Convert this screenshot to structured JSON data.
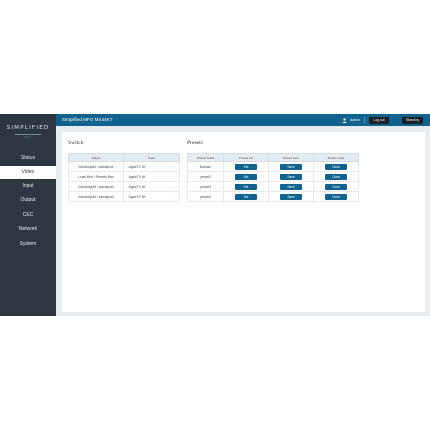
{
  "brand": {
    "logo_text": "SIMPLIFIED",
    "logo_sub": "MFG"
  },
  "sidebar": {
    "items": [
      {
        "label": "Status",
        "active": false
      },
      {
        "label": "Video",
        "active": true
      },
      {
        "label": "Input",
        "active": false
      },
      {
        "label": "Output",
        "active": false
      },
      {
        "label": "CEC",
        "active": false
      },
      {
        "label": "Network",
        "active": false
      },
      {
        "label": "System",
        "active": false
      }
    ]
  },
  "header": {
    "title": "Simplified MFG MX44KT",
    "user_icon": "user-icon",
    "user_name": "Admin",
    "logout_label": "Log out",
    "standby_label": "Stand by"
  },
  "switch": {
    "title": "Switch",
    "headers": [
      "Output",
      "Input"
    ],
    "rows": [
      {
        "output": "hdmioutput1 / catoutput1",
        "input": "AppleTV 4K"
      },
      {
        "output": "Local Mon / Remote Mon",
        "input": "AppleTV 4K"
      },
      {
        "output": "hdmioutput3 / catoutput3",
        "input": "AppleTV 4K"
      },
      {
        "output": "hdmioutput4 / catoutput4",
        "input": "AppleTV 4K"
      }
    ]
  },
  "presets": {
    "title": "Presets",
    "headers": [
      "Presets Name",
      "Presets Set",
      "Presets Save",
      "Presets Clear"
    ],
    "set_label": "Set",
    "save_label": "Save",
    "clear_label": "Clear",
    "rows": [
      {
        "name": "Batman"
      },
      {
        "name": "preset2"
      },
      {
        "name": "preset3"
      },
      {
        "name": "preset4"
      }
    ]
  },
  "colors": {
    "accent": "#11638e",
    "sidebar_bg": "#2e3740",
    "page_bg": "#e8ecef"
  }
}
